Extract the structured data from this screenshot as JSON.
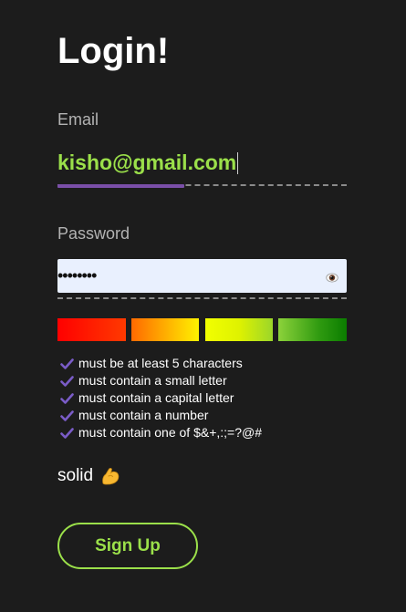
{
  "form": {
    "title": "Login!",
    "email": {
      "label": "Email",
      "value": "kisho@gmail.com"
    },
    "password": {
      "label": "Password",
      "masked_value": "••••••••",
      "reveal_icon": "eye-icon"
    },
    "strength_meter": {
      "segments": 4,
      "colors": [
        "#ff0000",
        "#ff8c00",
        "#f2ff00",
        "#6dc41c"
      ]
    },
    "rules": [
      "must be at least 5 characters",
      "must contain a small letter",
      "must contain a capital letter",
      "must contain a number",
      "must contain one of $&+,:;=?@#"
    ],
    "rule_icon": "check-icon",
    "rule_check_color": "#7a5cc7",
    "strength_label": "solid",
    "strength_emoji": "flexed-biceps-icon",
    "submit_label": "Sign Up"
  },
  "colors": {
    "background": "#1c1c1c",
    "accent_green": "#9be04a",
    "accent_purple": "#7a4fa8"
  }
}
